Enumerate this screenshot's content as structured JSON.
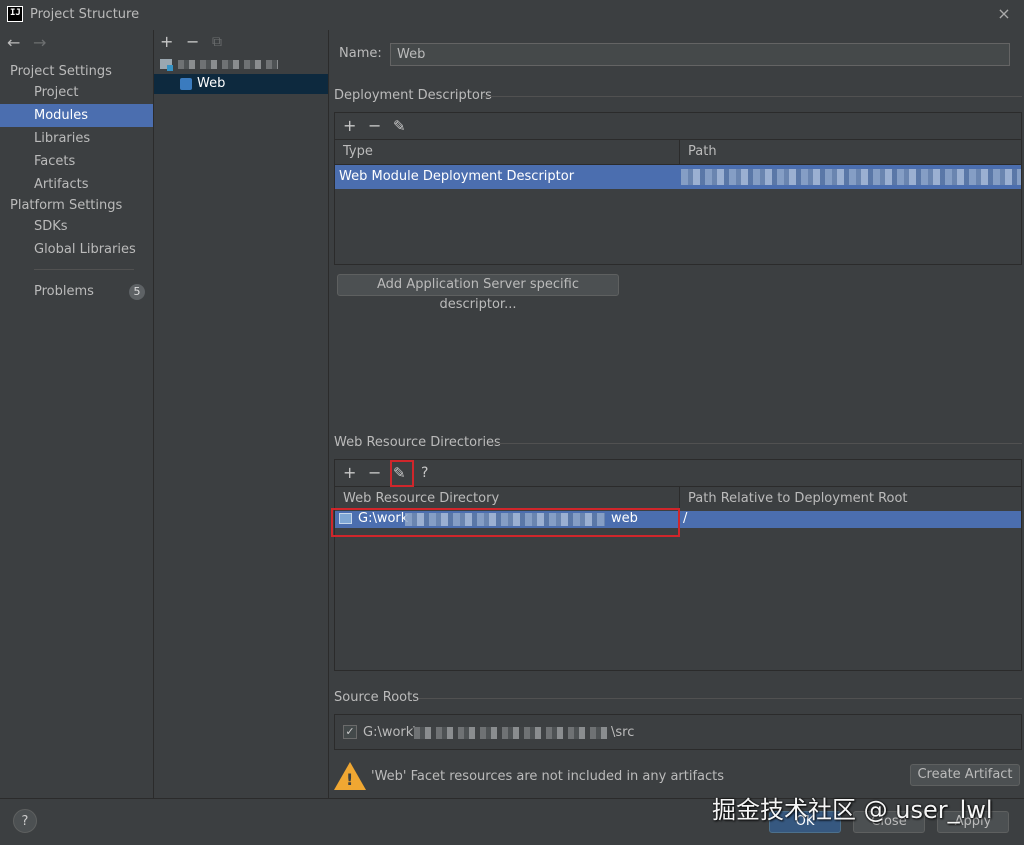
{
  "window": {
    "title": "Project Structure",
    "logo": "IJ",
    "close_icon": "×"
  },
  "sidebar": {
    "back_icon": "←",
    "forward_icon": "→",
    "project_settings_label": "Project Settings",
    "project_items": [
      "Project",
      "Modules",
      "Libraries",
      "Facets",
      "Artifacts"
    ],
    "platform_settings_label": "Platform Settings",
    "platform_items": [
      "SDKs",
      "Global Libraries"
    ],
    "problems_label": "Problems",
    "problems_count": "5"
  },
  "tree": {
    "add_icon": "+",
    "remove_icon": "−",
    "copy_icon": "⧉",
    "web_label": "Web"
  },
  "module": {
    "name_label": "Name:",
    "name_value": "Web"
  },
  "deployment": {
    "section_title": "Deployment Descriptors",
    "col_type": "Type",
    "col_path": "Path",
    "row_type": "Web Module Deployment Descriptor",
    "add_server_button": "Add Application Server specific descriptor..."
  },
  "web_resources": {
    "section_title": "Web Resource Directories",
    "help_icon": "?",
    "col_directory": "Web Resource Directory",
    "col_relative": "Path Relative to Deployment Root",
    "row_dir_prefix": "G:\\work",
    "row_dir_suffix": "web",
    "row_relative": "/"
  },
  "source_roots": {
    "section_title": "Source Roots",
    "path_prefix": "G:\\work\\",
    "path_suffix": "\\src",
    "checked_mark": "✓"
  },
  "warning": {
    "text": "'Web' Facet resources are not included in any artifacts",
    "create_artifact_button": "Create Artifact"
  },
  "footer": {
    "help_icon": "?",
    "ok_button": "OK",
    "close_button": "Close",
    "apply_button": "Apply"
  },
  "watermark": "掘金技术社区 @ user_lwl",
  "toolbar_icons": {
    "plus": "+",
    "minus": "−",
    "edit": "✎"
  },
  "colors": {
    "selection": "#4b6eaf",
    "highlight_box": "#d0262b",
    "warning": "#f0a732"
  }
}
